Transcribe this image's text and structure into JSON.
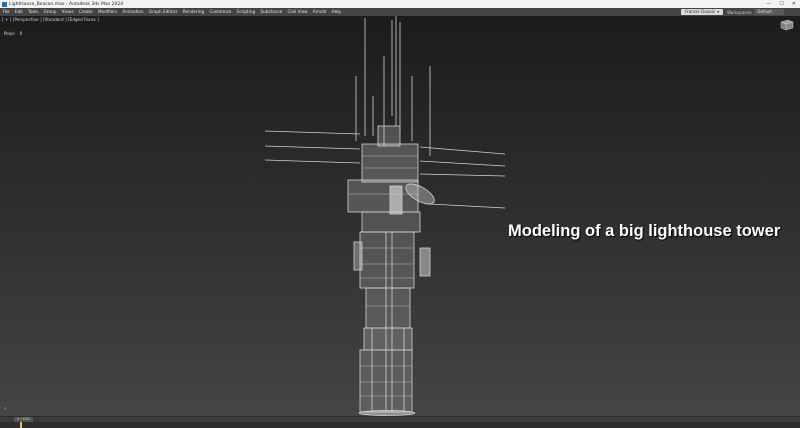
{
  "window": {
    "title": "LightHouse_Beacon.max - Autodesk 3ds Max 2024",
    "controls": [
      "—",
      "☐",
      "✕"
    ]
  },
  "menu": {
    "items": [
      "File",
      "Edit",
      "Tools",
      "Group",
      "Views",
      "Create",
      "Modifiers",
      "Animation",
      "Graph Editors",
      "Rendering",
      "Customize",
      "Scripting",
      "Substance",
      "Civil View",
      "Arnold",
      "Help"
    ],
    "sign_in": "Francis Clouvic",
    "workspaces_label": "Workspaces:",
    "workspace_value": "Default"
  },
  "viewport": {
    "label": "[ + ] [Perspective ] [Standard ] [Edged Faces ]",
    "stats_label": "Polys:",
    "stats_value": "0",
    "overlay_caption": "Modeling of a big lighthouse tower"
  },
  "timeline": {
    "frame_label": "0 / 100"
  },
  "colors": {
    "menubar": "#444444",
    "viewport_top": "#1c1c1c",
    "viewport_bottom": "#454545",
    "wire": "#d2d2d2"
  }
}
